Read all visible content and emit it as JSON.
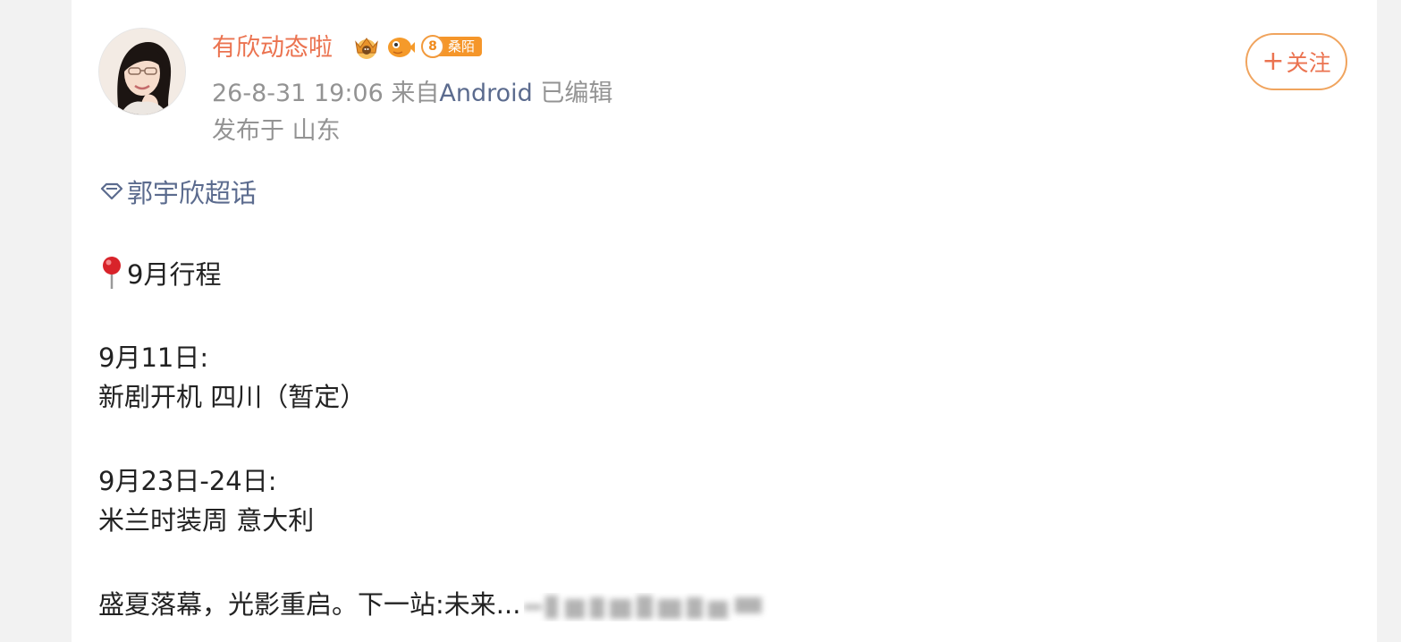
{
  "post": {
    "username": "有欣动态啦",
    "level_badge": {
      "level": "8",
      "name": "桑陌"
    },
    "timestamp": "26-8-31 19:06",
    "source_prefix": "来自",
    "source": "Android",
    "edited": "已编辑",
    "location": "发布于 山东",
    "follow_label": "关注",
    "follow_plus": "+",
    "topic": "郭宇欣超话",
    "body": {
      "heading": "9月行程",
      "item1_date": "9月11日:",
      "item1_desc": "新剧开机 四川（暂定）",
      "item2_date": "9月23日-24日:",
      "item2_desc": "米兰时装周 意大利",
      "closing": "盛夏落幕，光影重启。下一站:未来..."
    }
  },
  "icons": {
    "avatar": "avatar-photo",
    "crown": "crown-badge-icon",
    "fish": "fish-badge-icon",
    "topic": "diamond-topic-icon",
    "pin": "round-pushpin-icon"
  },
  "colors": {
    "username": "#eb7350",
    "link": "#5b6b8e",
    "meta": "#939393",
    "follow_border": "#f0a45e",
    "badge_orange": "#f5962a"
  }
}
